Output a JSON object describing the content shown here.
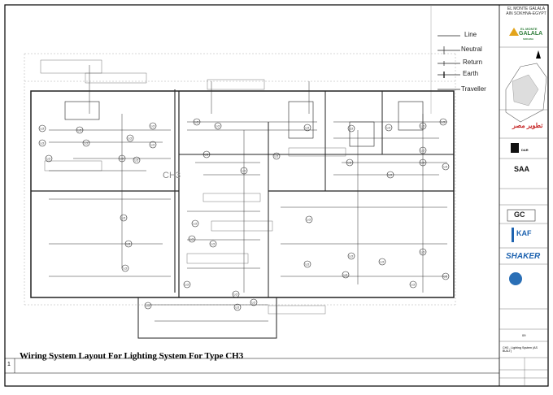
{
  "project": {
    "line1": "EL MONTE GALALA",
    "line2": "AIN SOKHNA-EGYPT",
    "logo_text": "GALALA",
    "logo_small": "EL MONTE",
    "logo_sub": "SOKHNA"
  },
  "drawing_title": "Wiring System Layout For Lighting System For Type CH3",
  "room_label": "CH3",
  "sheet_number": "1",
  "revision": "09",
  "drawing_name": "CH3 - Lighting System (AS BUILT)",
  "legend": [
    {
      "label": "Line",
      "symbol": "plain"
    },
    {
      "label": "Neutral",
      "symbol": "tick-long"
    },
    {
      "label": "Return",
      "symbol": "tick-short"
    },
    {
      "label": "Earth",
      "symbol": "tick-bar"
    },
    {
      "label": "Traveller",
      "symbol": "plain"
    }
  ],
  "consultants": [
    {
      "name": "tatweer-misr-logo",
      "text": "تطوير مصر"
    },
    {
      "name": "dar-logo",
      "text": "DAR"
    },
    {
      "name": "saa-logo",
      "text": "SAA"
    },
    {
      "name": "gc-logo",
      "text": "GC"
    },
    {
      "name": "kaf-logo",
      "text": "KAF"
    },
    {
      "name": "shaker-logo",
      "text": "SHAKER"
    }
  ],
  "fixture_label": "LO",
  "colors": {
    "line": "#222222",
    "accent_shaker": "#1e63b0",
    "accent_kaf": "#1e63b0",
    "accent_tatweer": "#c62828",
    "accent_galala": "#2f7d3a"
  }
}
